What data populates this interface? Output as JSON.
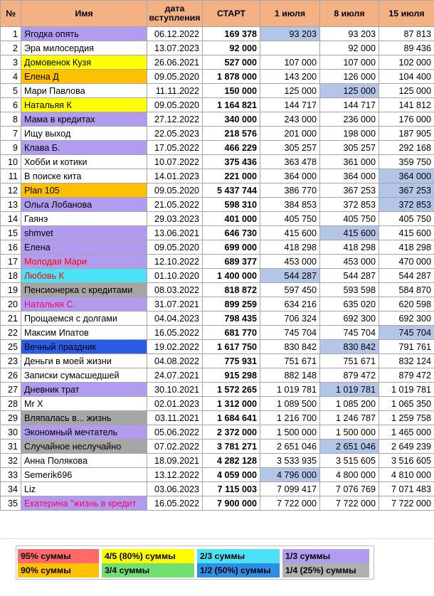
{
  "headers": {
    "num": "№",
    "name": "Имя",
    "date": "дата вступления",
    "start": "СТАРТ",
    "c1": "1 июля",
    "c2": "8 июля",
    "c3": "15 июля"
  },
  "colors": {
    "header": "#f4b183",
    "purple": "#b19cf0",
    "yellow": "#ffff00",
    "orange": "#ffc000",
    "cyan": "#4de1f7",
    "gray": "#a6a6a6",
    "blue": "#2b5ce6",
    "highlight": "#b4c6e7"
  },
  "rows": [
    {
      "num": "1",
      "name": "Ягодка опять",
      "date": "06.12.2022",
      "start": "169 378",
      "c1": "93 203",
      "c2": "93 203",
      "c3": "87 813",
      "bg": "purple",
      "hl": [
        1
      ]
    },
    {
      "num": "2",
      "name": "Эра милосердия",
      "date": "13.07.2023",
      "start": "92 000",
      "c1": "",
      "c2": "92 000",
      "c3": "89 436",
      "bg": "",
      "hl": []
    },
    {
      "num": "3",
      "name": "Домовенок Кузя",
      "date": "26.06.2021",
      "start": "527 000",
      "c1": "107 000",
      "c2": "107 000",
      "c3": "102 000",
      "bg": "yellow",
      "hl": []
    },
    {
      "num": "4",
      "name": "Елена Д",
      "date": "09.05.2020",
      "start": "1 878 000",
      "c1": "143 200",
      "c2": "126 000",
      "c3": "104 400",
      "bg": "orange",
      "hl": []
    },
    {
      "num": "5",
      "name": "Мари Павлова",
      "date": "11.11.2022",
      "start": "150 000",
      "c1": "125 000",
      "c2": "125 000",
      "c3": "125 000",
      "bg": "",
      "hl": [
        2
      ]
    },
    {
      "num": "6",
      "name": "Натальяя К",
      "date": "09.05.2020",
      "start": "1 164 821",
      "c1": "144 717",
      "c2": "144 717",
      "c3": "141 812",
      "bg": "yellow",
      "hl": []
    },
    {
      "num": "8",
      "name": "Мама в кредитах",
      "date": "27.12.2022",
      "start": "340 000",
      "c1": "243 000",
      "c2": "236 000",
      "c3": "176 000",
      "bg": "purple",
      "hl": []
    },
    {
      "num": "7",
      "name": "Ищу выход",
      "date": "22.05.2023",
      "start": "218 576",
      "c1": "201 000",
      "c2": "198 000",
      "c3": "187 905",
      "bg": "",
      "hl": []
    },
    {
      "num": "9",
      "name": "Клава Б.",
      "date": "17.05.2022",
      "start": "466 229",
      "c1": "305 257",
      "c2": "305 257",
      "c3": "292 168",
      "bg": "purple",
      "hl": []
    },
    {
      "num": "10",
      "name": "Хобби и котики",
      "date": "10.07.2022",
      "start": "375 436",
      "c1": "363 478",
      "c2": "361 000",
      "c3": "359 750",
      "bg": "",
      "hl": []
    },
    {
      "num": "11",
      "name": "В поиске кита",
      "date": "14.01.2023",
      "start": "221 000",
      "c1": "364 000",
      "c2": "364 000",
      "c3": "364 000",
      "bg": "",
      "hl": [
        3
      ]
    },
    {
      "num": "12",
      "name": "Plan 105",
      "date": "09.05.2020",
      "start": "5 437 744",
      "c1": "386 770",
      "c2": "367 253",
      "c3": "367 253",
      "bg": "orange",
      "hl": [
        3
      ]
    },
    {
      "num": "13",
      "name": "Ольга Лобанова",
      "date": "21.05.2022",
      "start": "598 310",
      "c1": "384 853",
      "c2": "372 853",
      "c3": "372 853",
      "bg": "purple",
      "hl": [
        3
      ]
    },
    {
      "num": "14",
      "name": "Гаянэ",
      "date": "29.03.2023",
      "start": "401 000",
      "c1": "405 750",
      "c2": "405 750",
      "c3": "405 750",
      "bg": "",
      "hl": []
    },
    {
      "num": "15",
      "name": "shmvet",
      "date": "13.06.2021",
      "start": "646 730",
      "c1": "415 600",
      "c2": "415 600",
      "c3": "415 600",
      "bg": "purple",
      "hl": [
        2
      ]
    },
    {
      "num": "16",
      "name": "Елена",
      "date": "09.05.2020",
      "start": "699 000",
      "c1": "418 298",
      "c2": "418 298",
      "c3": "418 298",
      "bg": "purple",
      "hl": []
    },
    {
      "num": "17",
      "name": "Молодая Мари",
      "date": "12.10.2022",
      "start": "689 377",
      "c1": "453 000",
      "c2": "453 000",
      "c3": "470 000",
      "bg": "purple",
      "text": "red",
      "hl": []
    },
    {
      "num": "18",
      "name": "Любовь К",
      "date": "01.10.2020",
      "start": "1 400 000",
      "c1": "544 287",
      "c2": "544 287",
      "c3": "544 287",
      "bg": "cyan",
      "text": "red",
      "hl": [
        1
      ]
    },
    {
      "num": "19",
      "name": "Пенсионерка с кредитами",
      "date": "08.03.2022",
      "start": "818 872",
      "c1": "597 450",
      "c2": "593 598",
      "c3": "584 870",
      "bg": "gray",
      "hl": []
    },
    {
      "num": "20",
      "name": "Натальяя С.",
      "date": "31.07.2021",
      "start": "899 259",
      "c1": "634 216",
      "c2": "635 020",
      "c3": "620 598",
      "bg": "purple",
      "text": "pink",
      "hl": []
    },
    {
      "num": "21",
      "name": "Прощаемся с долгами",
      "date": "04.04.2023",
      "start": "798 435",
      "c1": "706 324",
      "c2": "692 300",
      "c3": "692 300",
      "bg": "",
      "hl": []
    },
    {
      "num": "22",
      "name": "Максим Ипатов",
      "date": "16.05.2022",
      "start": "681 770",
      "c1": "745 704",
      "c2": "745 704",
      "c3": "745 704",
      "bg": "",
      "hl": [
        3
      ]
    },
    {
      "num": "25",
      "name": "Вечный праздник",
      "date": "19.02.2022",
      "start": "1 617 750",
      "c1": "830 842",
      "c2": "830 842",
      "c3": "791 761",
      "bg": "blue",
      "hl": [
        2
      ]
    },
    {
      "num": "23",
      "name": "Деньги в моей жизни",
      "date": "04.08.2022",
      "start": "775 931",
      "c1": "751 671",
      "c2": "751 671",
      "c3": "832 124",
      "bg": "",
      "hl": []
    },
    {
      "num": "26",
      "name": "Записки сумасшедшей",
      "date": "24.07.2021",
      "start": "915 298",
      "c1": "882 148",
      "c2": "879 472",
      "c3": "879 472",
      "bg": "",
      "hl": []
    },
    {
      "num": "27",
      "name": "Дневник трат",
      "date": "30.10.2021",
      "start": "1 572 265",
      "c1": "1 019 781",
      "c2": "1 019 781",
      "c3": "1 019 781",
      "bg": "purple",
      "hl": [
        2
      ]
    },
    {
      "num": "28",
      "name": "Mr X",
      "date": "02.01.2023",
      "start": "1 312 000",
      "c1": "1 089 500",
      "c2": "1 085 200",
      "c3": "1 065 350",
      "bg": "",
      "hl": []
    },
    {
      "num": "29",
      "name": "Вляпалась в... жизнь",
      "date": "03.11.2021",
      "start": "1 684 641",
      "c1": "1 216 700",
      "c2": "1 246 787",
      "c3": "1 259 758",
      "bg": "gray",
      "hl": []
    },
    {
      "num": "30",
      "name": "Экономный мечтатель",
      "date": "05.06.2022",
      "start": "2 372 000",
      "c1": "1 500 000",
      "c2": "1 500 000",
      "c3": "1 465 000",
      "bg": "purple",
      "hl": []
    },
    {
      "num": "31",
      "name": "Случайное неслучайно",
      "date": "07.02.2022",
      "start": "3 781 271",
      "c1": "2 651 046",
      "c2": "2 651 046",
      "c3": "2 649 239",
      "bg": "gray",
      "hl": [
        2
      ]
    },
    {
      "num": "32",
      "name": "Анна Полякова",
      "date": "18.09.2021",
      "start": "4 282 128",
      "c1": "3 533 935",
      "c2": "3 515 605",
      "c3": "3 516 605",
      "bg": "",
      "hl": []
    },
    {
      "num": "33",
      "name": "Semerik696",
      "date": "13.12.2022",
      "start": "4 059 000",
      "c1": "4 796 000",
      "c2": "4 800 000",
      "c3": "4 810 000",
      "bg": "",
      "hl": [
        1
      ]
    },
    {
      "num": "34",
      "name": "Liz",
      "date": "03.06.2023",
      "start": "7 115 003",
      "c1": "7 099 417",
      "c2": "7 076 769",
      "c3": "7 071 483",
      "bg": "",
      "hl": []
    },
    {
      "num": "35",
      "name": "Екатерина \"жизнь в кредит",
      "date": "16.05.2022",
      "start": "7 900 000",
      "c1": "7 722 000",
      "c2": "7 722 000",
      "c3": "7 722 000",
      "bg": "purple",
      "text": "pink",
      "hl": []
    }
  ],
  "legend": [
    {
      "label": "95% суммы",
      "color": "#ff6b6b"
    },
    {
      "label": "4/5 (80%) суммы",
      "color": "#ffff00"
    },
    {
      "label": "2/3 суммы",
      "color": "#4de1f7"
    },
    {
      "label": "1/3 суммы",
      "color": "#b19cf0"
    },
    {
      "label": "90% суммы",
      "color": "#ffc000"
    },
    {
      "label": "3/4 суммы",
      "color": "#70e070"
    },
    {
      "label": "1/2 (50%) суммы",
      "color": "#2b8fe6"
    },
    {
      "label": "1/4 (25%) суммы",
      "color": "#b0b0b0"
    }
  ]
}
